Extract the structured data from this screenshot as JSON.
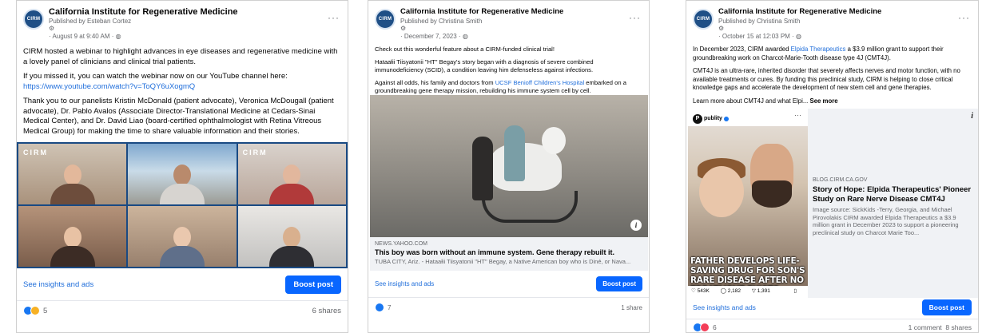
{
  "posts": [
    {
      "page_name": "California Institute for Regenerative Medicine",
      "avatar_text": "CIRM",
      "published_by": "Published by Esteban Cortez",
      "date": "· August 9 at 9:40 AM · ",
      "body": [
        "CIRM hosted a webinar to highlight advances in eye diseases and regenerative medicine with a lovely panel of clinicians and clinical trial patients.",
        "If you missed it, you can watch the webinar now on our YouTube channel here:",
        "Thank you to our panelists Kristin McDonald (patient advocate), Veronica McDougall (patient advocate), Dr. Pablo Avalos (Associate Director-Translational Medicine at Cedars-Sinai Medical Center), and Dr. David Liao (board-certified ophthalmologist with Retina Vitreous Medical Group) for making the time to share valuable information and their stories."
      ],
      "link": "https://www.youtube.com/watch?v=ToQY6uXogmQ",
      "video_brand": "CIRM",
      "insights": "See insights and ads",
      "boost": "Boost post",
      "reaction_count": "5",
      "shares": "6 shares"
    },
    {
      "page_name": "California Institute for Regenerative Medicine",
      "avatar_text": "CIRM",
      "published_by": "Published by Christina Smith",
      "date": "· December 7, 2023 · ",
      "body_1": "Check out this wonderful feature about a CIRM-funded clinical trial!",
      "body_2": "Hataałii Tiisyatonii \"HT\" Begay's story began with a diagnosis of severe combined immunodeficiency (SCID), a condition leaving him defenseless against infections.",
      "body_3_pre": "Against all odds, his family and doctors from ",
      "body_3_link": "UCSF Benioff Children's Hospital",
      "body_3_post": " embarked on a groundbreaking gene therapy mission, rebuilding his immune system cell by cell.",
      "link_domain": "NEWS.YAHOO.COM",
      "link_title": "This boy was born without an immune system. Gene therapy rebuilt it.",
      "link_desc": "TUBA CITY, Ariz. - Hataałii Tiisyatonii \"HT\" Begay, a Native American boy who is Diné, or Nava...",
      "insights": "See insights and ads",
      "boost": "Boost post",
      "reaction_count": "7",
      "shares": "1 share"
    },
    {
      "page_name": "California Institute for Regenerative Medicine",
      "avatar_text": "CIRM",
      "published_by": "Published by Christina Smith",
      "date": "· October 15 at 12:03 PM · ",
      "body_1_pre": "In December 2023, CIRM awarded ",
      "body_1_link": "Elpida Therapeutics",
      "body_1_post": " a $3.9 million grant to support their groundbreaking work on Charcot-Marie-Tooth disease type 4J (CMT4J).",
      "body_2": "CMT4J is an ultra-rare, inherited disorder that severely affects nerves and motor function, with no available treatments or cures. By funding this preclinical study, CIRM is helping to close critical knowledge gaps and accelerate the development of new stem cell and gene therapies.",
      "body_3": "Learn more about CMT4J and what Elpi...",
      "see_more": "See more",
      "image_page": "publity",
      "image_overlay": "FATHER DEVELOPS LIFE-SAVING DRUG FOR SON'S RARE DISEASE AFTER NO TREATMENT EXISTS",
      "image_stats": [
        "543K",
        "2,182",
        "1,391"
      ],
      "link_domain": "BLOG.CIRM.CA.GOV",
      "link_title": "Story of Hope: Elpida Therapeutics' Pioneer Study on Rare Nerve Disease CMT4J",
      "link_desc": "Image source: SickKids -Terry, Georgia, and Michael Pirovolakis CIRM awarded Elpida Therapeutics a $3.9 million grant in December 2023 to support a pioneering preclinical study on Charcot Marie Too...",
      "insights": "See insights and ads",
      "boost": "Boost post",
      "reaction_count": "6",
      "stats": "1 comment  8 shares"
    }
  ],
  "icons": {
    "more": "more-options-icon",
    "globe": "globe-icon",
    "info": "info-icon",
    "like": "like-reaction-icon",
    "love": "love-reaction-icon"
  },
  "colors": {
    "link": "#216fdb",
    "boost": "#0866ff",
    "like": "#1877f2",
    "love": "#f33e58"
  }
}
